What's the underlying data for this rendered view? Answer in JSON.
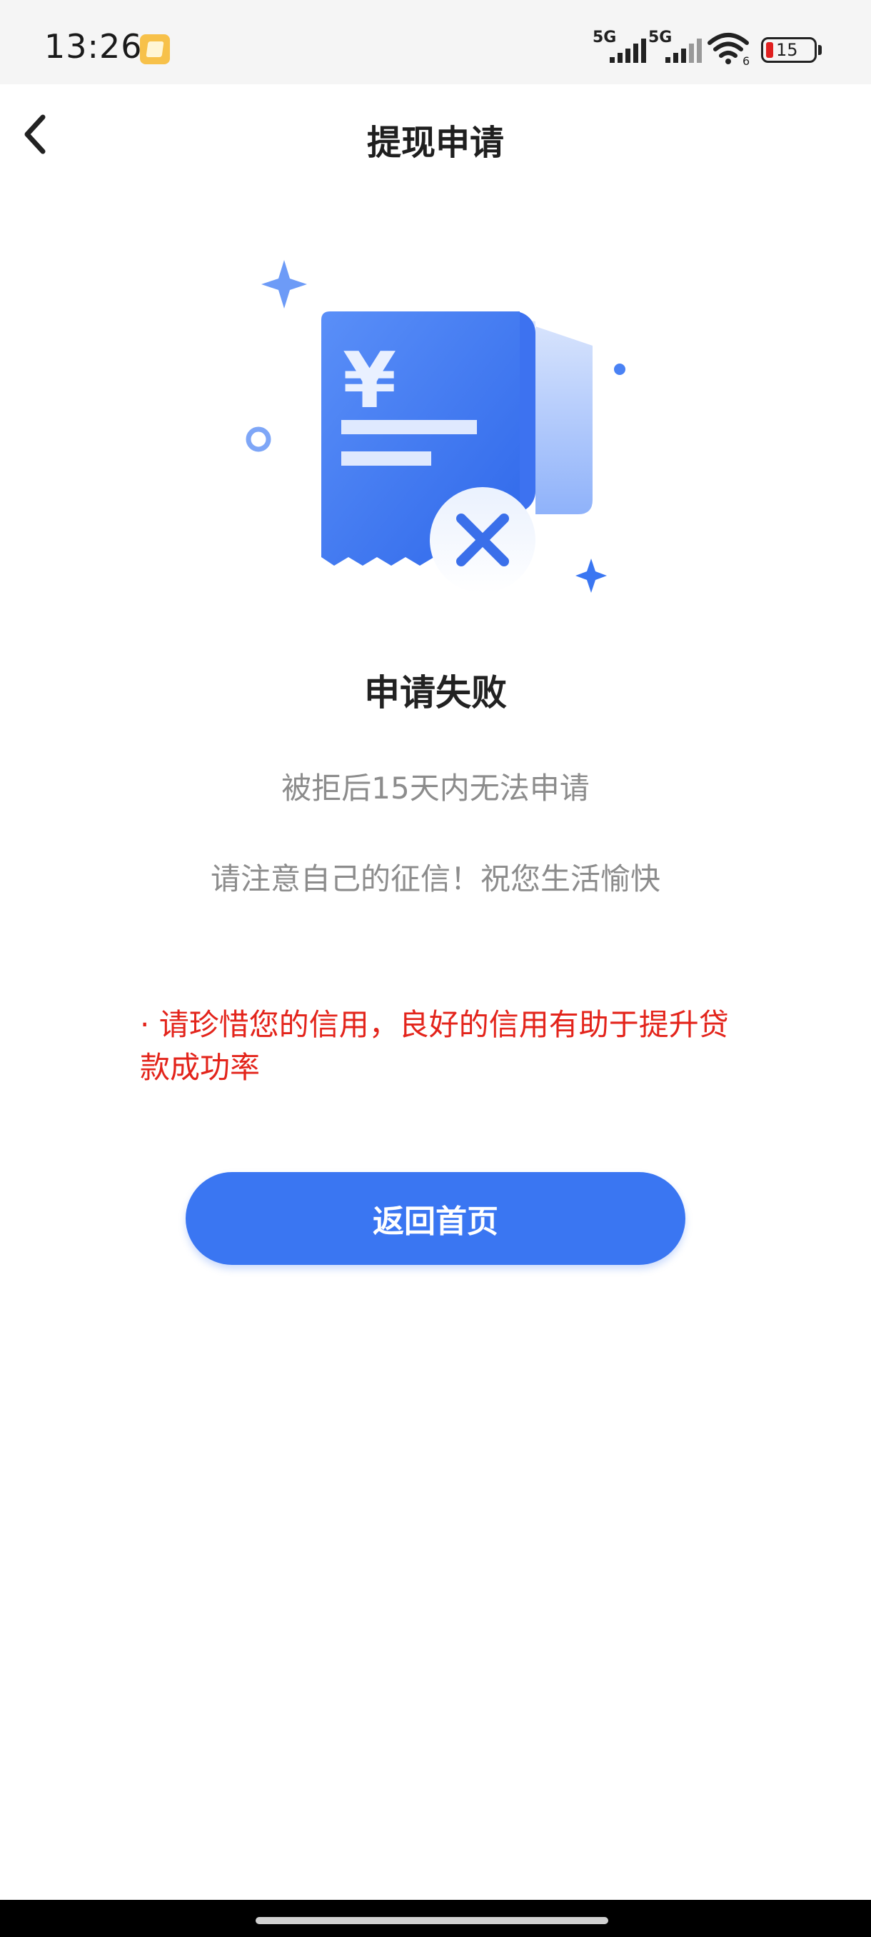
{
  "status_bar": {
    "time": "13:26",
    "signal_1_label": "5G",
    "signal_2_label": "5G",
    "wifi_sub": "6",
    "battery": "15"
  },
  "nav": {
    "title": "提现申请"
  },
  "result": {
    "title": "申请失败",
    "subtitle_1": "被拒后15天内无法申请",
    "subtitle_2": "请注意自己的征信！祝您生活愉快",
    "warning": "· 请珍惜您的信用，良好的信用有助于提升贷款成功率"
  },
  "illustration": {
    "currency_symbol": "¥"
  },
  "button": {
    "label": "返回首页"
  },
  "colors": {
    "accent": "#3a76f2",
    "warning": "#e3241b",
    "muted_text": "#8c8c8c"
  }
}
